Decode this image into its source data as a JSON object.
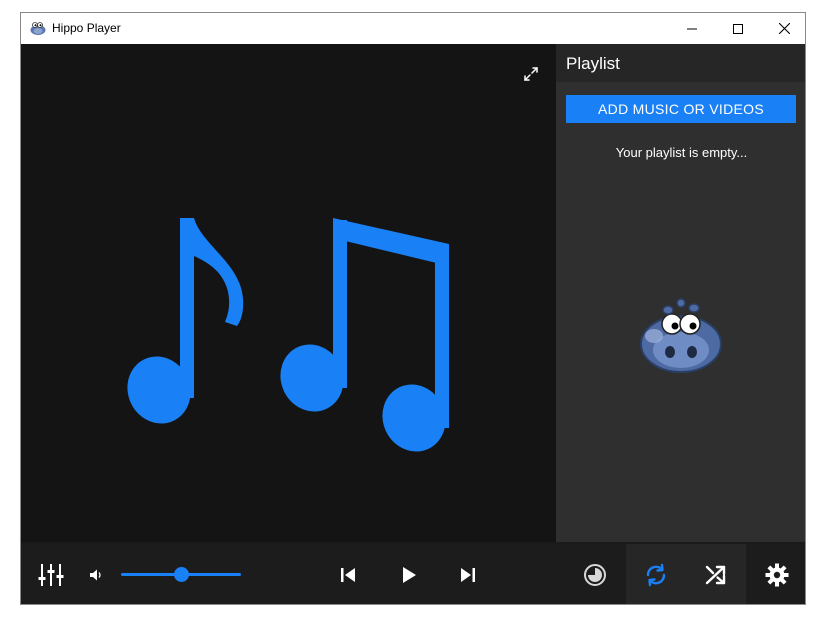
{
  "window": {
    "title": "Hippo Player",
    "app_icon": "hippo-icon",
    "controls": {
      "minimize_icon": "minimize-icon",
      "maximize_icon": "maximize-icon",
      "close_icon": "close-icon"
    }
  },
  "video": {
    "placeholder_icon": "music-notes-icon",
    "expand_icon": "expand-icon"
  },
  "playlist": {
    "title": "Playlist",
    "add_button_label": "ADD MUSIC OR VIDEOS",
    "empty_message": "Your playlist is empty...",
    "mascot": "hippo-mascot"
  },
  "controls": {
    "equalizer_icon": "equalizer-icon",
    "volume_icon": "volume-icon",
    "volume_level": 0.5,
    "previous_icon": "skip-previous-icon",
    "play_icon": "play-icon",
    "next_icon": "skip-next-icon",
    "timer_icon": "timer-icon",
    "repeat_icon": "repeat-icon",
    "repeat_active": true,
    "shuffle_icon": "shuffle-icon",
    "shuffle_active": false,
    "settings_icon": "settings-icon"
  },
  "colors": {
    "accent": "#1a80f5",
    "background": "#141414",
    "panel": "#2f2f2f",
    "controlbar": "#1c1c1c"
  }
}
